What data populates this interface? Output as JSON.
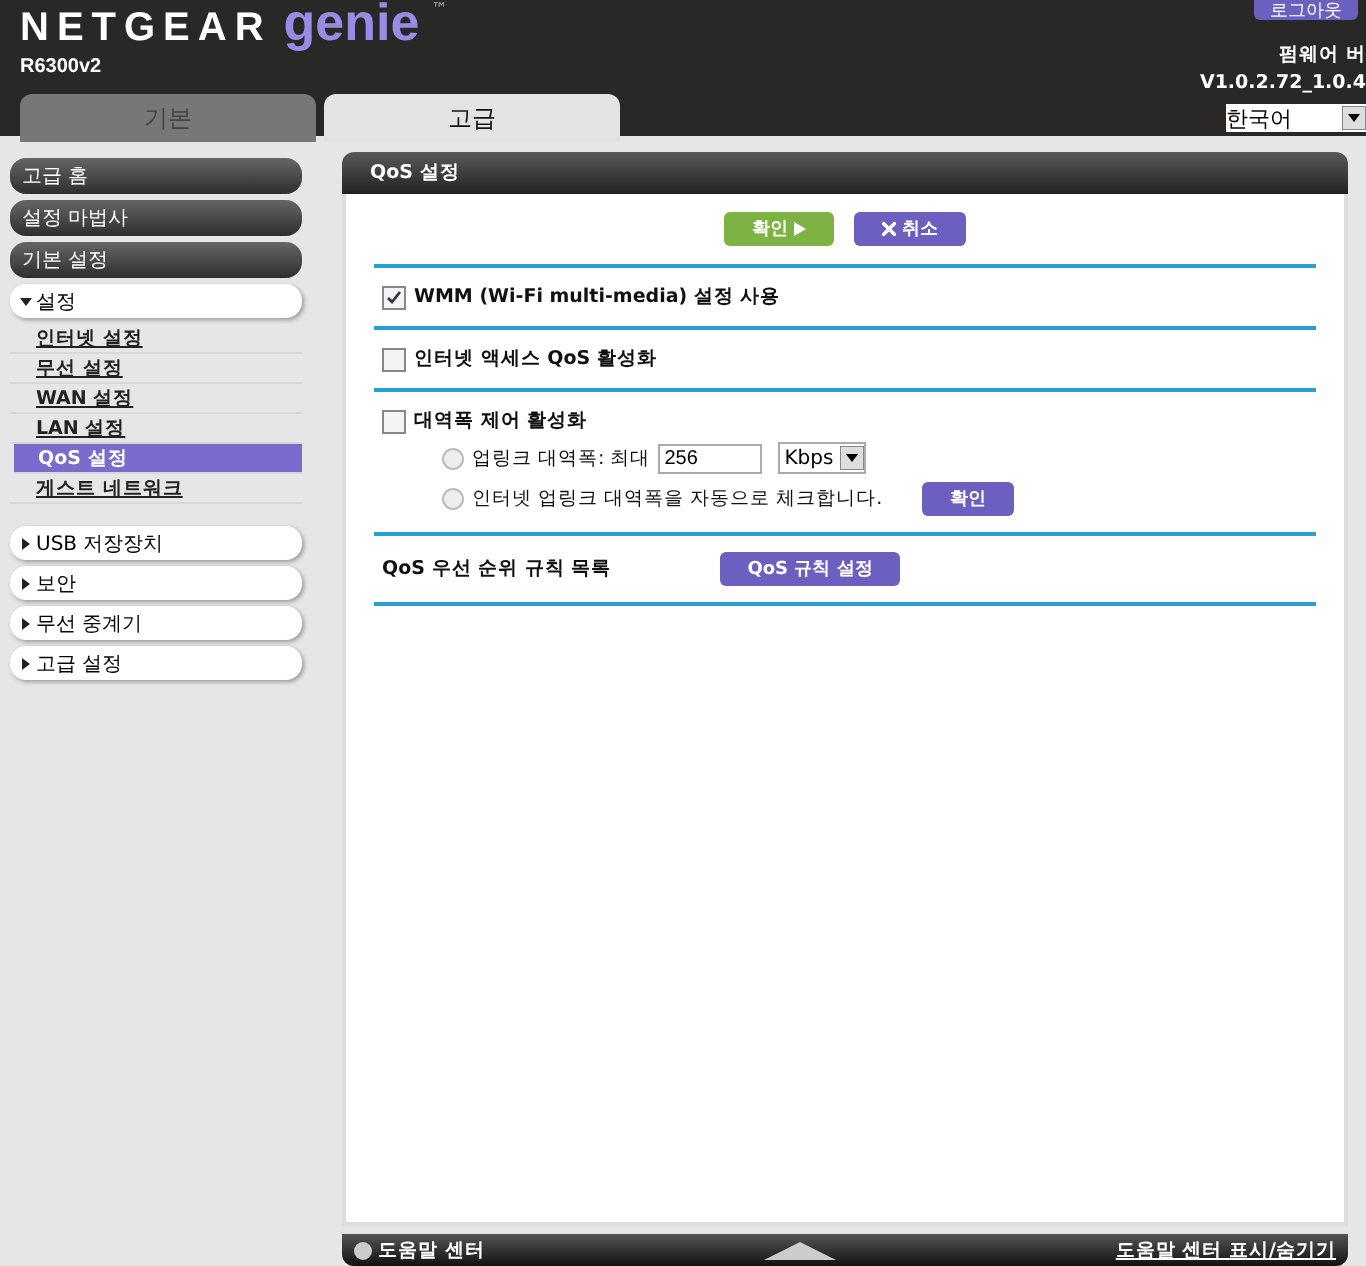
{
  "header": {
    "logo_brand": "NETGEAR",
    "logo_product": "genie",
    "logo_tm": "™",
    "model": "R6300v2",
    "logout": "로그아웃",
    "firmware_label": "펌웨어 버",
    "firmware_version": "V1.0.2.72_1.0.4",
    "language": "한국어"
  },
  "tabs": [
    {
      "label": "기본",
      "selected": false
    },
    {
      "label": "고급",
      "selected": true
    }
  ],
  "sidebar": [
    {
      "kind": "dark",
      "label": "고급 홈"
    },
    {
      "kind": "dark",
      "label": "설정 마법사"
    },
    {
      "kind": "dark",
      "label": "기본 설정"
    },
    {
      "kind": "section",
      "label": "설정",
      "expanded": true,
      "children": [
        {
          "label": "인터넷 설정",
          "selected": false
        },
        {
          "label": "무선 설정",
          "selected": false
        },
        {
          "label": "WAN 설정",
          "selected": false
        },
        {
          "label": "LAN 설정",
          "selected": false
        },
        {
          "label": "QoS 설정",
          "selected": true
        },
        {
          "label": "게스트 네트워크",
          "selected": false
        }
      ]
    },
    {
      "kind": "section",
      "label": "USB 저장장치",
      "expanded": false
    },
    {
      "kind": "section",
      "label": "보안",
      "expanded": false
    },
    {
      "kind": "section",
      "label": "무선 중계기",
      "expanded": false
    },
    {
      "kind": "section",
      "label": "고급 설정",
      "expanded": false
    }
  ],
  "panel": {
    "title": "QoS 설정",
    "apply": "확인",
    "cancel": "취소",
    "wmm": {
      "label": "WMM (Wi-Fi multi-media) 설정 사용",
      "checked": true
    },
    "internet_qos": {
      "label": "인터넷 액세스 QoS 활성화",
      "checked": false
    },
    "bandwidth": {
      "label": "대역폭 제어 활성화",
      "checked": false,
      "options": [
        {
          "label": "업링크 대역폭: 최대",
          "selected": false,
          "value": "256",
          "unit": "Kbps"
        },
        {
          "label": "인터넷 업링크 대역폭을 자동으로 체크합니다.",
          "selected": false,
          "button": "확인"
        }
      ]
    },
    "rules": {
      "label": "QoS 우선 순위 규칙 목록",
      "button": "QoS 규칙 설정"
    }
  },
  "footer": {
    "help": "도움말 센터",
    "toggle": "도움말 센터 표시/숨기기"
  }
}
